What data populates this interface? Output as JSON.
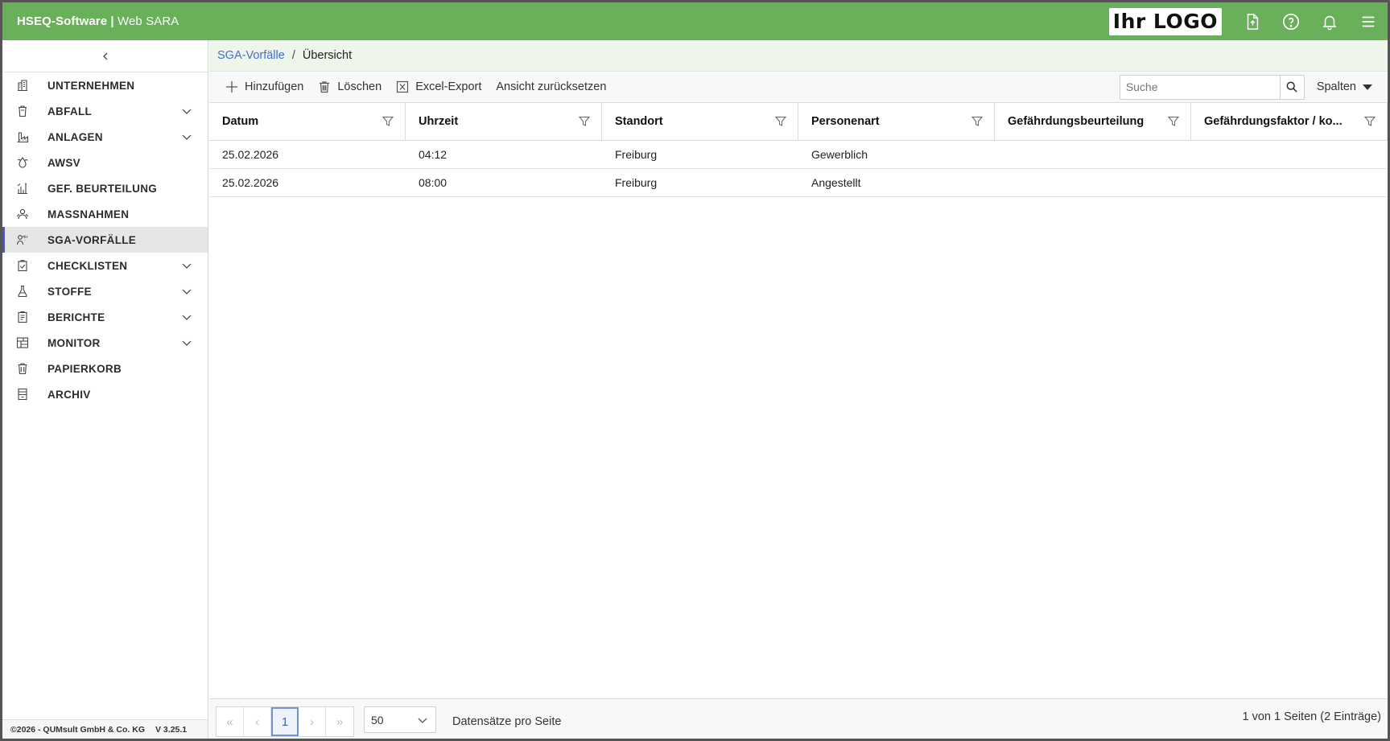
{
  "header": {
    "brand_bold": "HSEQ-Software",
    "brand_sep": " | ",
    "brand_rest": "Web SARA",
    "logo_text": "Ihr LOGO"
  },
  "sidebar": {
    "items": [
      {
        "label": "UNTERNEHMEN",
        "icon": "building-icon",
        "expandable": false
      },
      {
        "label": "ABFALL",
        "icon": "waste-bin-icon",
        "expandable": true
      },
      {
        "label": "ANLAGEN",
        "icon": "factory-icon",
        "expandable": true
      },
      {
        "label": "AWSV",
        "icon": "water-drop-icon",
        "expandable": false
      },
      {
        "label": "GEF. BEURTEILUNG",
        "icon": "risk-chart-icon",
        "expandable": false
      },
      {
        "label": "MASSNAHMEN",
        "icon": "people-gear-icon",
        "expandable": false
      },
      {
        "label": "SGA-VORFÄLLE",
        "icon": "person-alert-icon",
        "expandable": false,
        "active": true
      },
      {
        "label": "CHECKLISTEN",
        "icon": "clipboard-check-icon",
        "expandable": true
      },
      {
        "label": "STOFFE",
        "icon": "flask-icon",
        "expandable": true
      },
      {
        "label": "BERICHTE",
        "icon": "report-icon",
        "expandable": true
      },
      {
        "label": "MONITOR",
        "icon": "monitor-grid-icon",
        "expandable": true
      },
      {
        "label": "PAPIERKORB",
        "icon": "trash-icon",
        "expandable": false
      },
      {
        "label": "ARCHIV",
        "icon": "archive-icon",
        "expandable": false
      }
    ],
    "footer_copyright": "©2026 - QUMsult GmbH & Co. KG",
    "footer_version": "V 3.25.1"
  },
  "breadcrumb": {
    "link": "SGA-Vorfälle",
    "separator": "/",
    "current": "Übersicht"
  },
  "toolbar": {
    "add_label": "Hinzufügen",
    "delete_label": "Löschen",
    "export_label": "Excel-Export",
    "reset_label": "Ansicht zurücksetzen",
    "search_placeholder": "Suche",
    "columns_label": "Spalten"
  },
  "grid": {
    "columns": [
      "Datum",
      "Uhrzeit",
      "Standort",
      "Personenart",
      "Gefährdungsbeurteilung",
      "Gefährdungsfaktor / ko..."
    ],
    "rows": [
      [
        "25.02.2026",
        "04:12",
        "Freiburg",
        "Gewerblich",
        "",
        ""
      ],
      [
        "25.02.2026",
        "08:00",
        "Freiburg",
        "Angestellt",
        "",
        ""
      ]
    ]
  },
  "pager": {
    "first": "«",
    "prev": "‹",
    "current_page": "1",
    "next": "›",
    "last": "»",
    "page_size": "50",
    "per_page_label": "Datensätze pro Seite",
    "info": "1 von 1 Seiten (2 Einträge)"
  },
  "colors": {
    "header_bg": "#6aaf5a",
    "breadcrumb_bg": "#eef6ec",
    "link": "#3f6fc8",
    "active_indicator": "#4a55c9"
  }
}
